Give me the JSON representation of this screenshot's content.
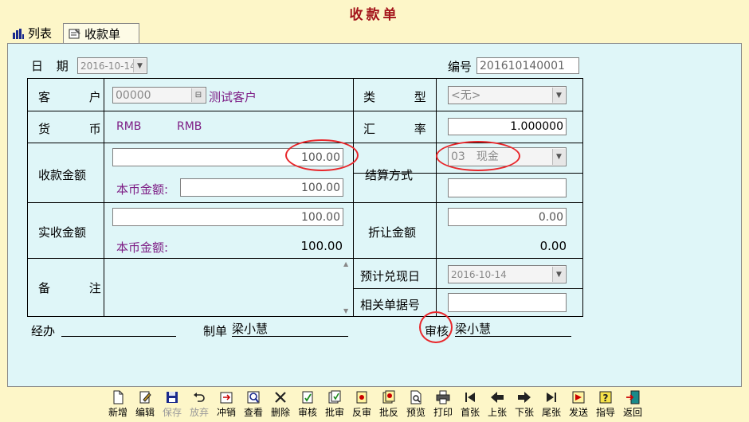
{
  "window": {
    "title": "收款单"
  },
  "tabs": [
    {
      "label": "列表"
    },
    {
      "label": "收款单"
    }
  ],
  "header": {
    "date_label": "日 期",
    "date_value": "2016-10-14",
    "number_label": "编号",
    "number_value": "201610140001"
  },
  "form": {
    "customer_label": "客 户",
    "customer_code": "00000",
    "customer_name": "测试客户",
    "type_label": "类 型",
    "type_value": "<无>",
    "currency_label": "货 币",
    "currency_code_1": "RMB",
    "currency_code_2": "RMB",
    "rate_label": "汇 率",
    "rate_value": "1.000000",
    "amount_label": "收款金额",
    "amount_value": "100.00",
    "local_amount_label": "本币金额:",
    "local_amount_value": "100.00",
    "settle_label": "结算方式",
    "settle_value": "03　现金",
    "settle_extra": "",
    "actual_label": "实收金额",
    "actual_value": "100.00",
    "actual_local_label": "本币金额:",
    "actual_local_value": "100.00",
    "discount_label": "折让金额",
    "discount_value": "0.00",
    "discount_local_value": "0.00",
    "remark_label": "备 注",
    "remark_value": "",
    "expected_date_label": "预计兑现日",
    "expected_date_value": "2016-10-14",
    "related_doc_label": "相关单据号",
    "related_doc_value": ""
  },
  "footer": {
    "handler_label": "经办",
    "handler_value": "",
    "maker_label": "制单",
    "maker_value": "梁小慧",
    "auditor_label": "审核",
    "auditor_value": "梁小慧"
  },
  "toolbar": [
    {
      "label": "新增",
      "icon": "new-doc-icon",
      "enabled": true
    },
    {
      "label": "编辑",
      "icon": "edit-icon",
      "enabled": true
    },
    {
      "label": "保存",
      "icon": "save-icon",
      "enabled": false
    },
    {
      "label": "放弃",
      "icon": "undo-icon",
      "enabled": false
    },
    {
      "label": "冲销",
      "icon": "reverse-icon",
      "enabled": true
    },
    {
      "label": "查看",
      "icon": "view-icon",
      "enabled": true
    },
    {
      "label": "删除",
      "icon": "delete-icon",
      "enabled": true
    },
    {
      "label": "审核",
      "icon": "audit-icon",
      "enabled": true
    },
    {
      "label": "批审",
      "icon": "batch-audit-icon",
      "enabled": true
    },
    {
      "label": "反审",
      "icon": "unaudit-icon",
      "enabled": true
    },
    {
      "label": "批反",
      "icon": "batch-unaudit-icon",
      "enabled": true
    },
    {
      "label": "预览",
      "icon": "preview-icon",
      "enabled": true
    },
    {
      "label": "打印",
      "icon": "print-icon",
      "enabled": true
    },
    {
      "label": "首张",
      "icon": "first-icon",
      "enabled": true
    },
    {
      "label": "上张",
      "icon": "prev-icon",
      "enabled": true
    },
    {
      "label": "下张",
      "icon": "next-icon",
      "enabled": true
    },
    {
      "label": "尾张",
      "icon": "last-icon",
      "enabled": true
    },
    {
      "label": "发送",
      "icon": "send-icon",
      "enabled": true
    },
    {
      "label": "指导",
      "icon": "help-icon",
      "enabled": true
    },
    {
      "label": "返回",
      "icon": "exit-icon",
      "enabled": true
    }
  ],
  "colors": {
    "panel_bg": "#dff6f8",
    "page_bg": "#fdf6c8",
    "title": "#a3131a",
    "label_purple": "#7d1d85",
    "highlight_circle": "#e8262a"
  }
}
